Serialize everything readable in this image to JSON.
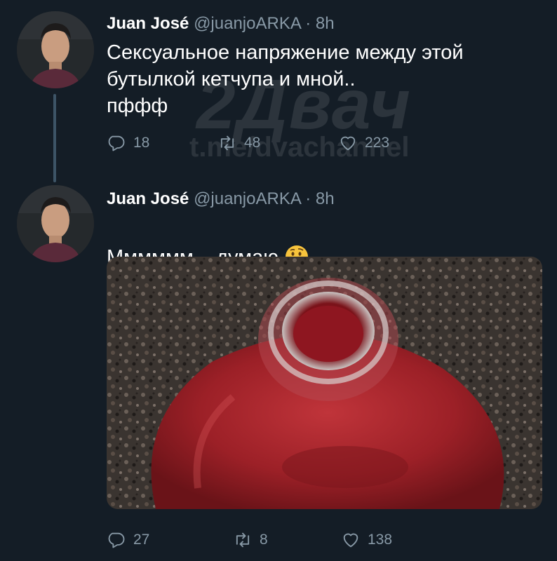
{
  "tweets": [
    {
      "name": "Juan José",
      "handle": "@juanjoARKA",
      "separator": "·",
      "time": "8h",
      "text": "Сексуальное напряжение между этой\nбутылкой кетчупа и мной..\nпффф",
      "replies": "18",
      "retweets": "48",
      "likes": "223"
    },
    {
      "name": "Juan José",
      "handle": "@juanjoARKA",
      "separator": "·",
      "time": "8h",
      "text": "Мммммм... думаю",
      "emoji": "thinking-face-emoji",
      "replies": "27",
      "retweets": "8",
      "likes": "138"
    }
  ],
  "watermark": {
    "brand": "2Двач",
    "channel": "t.me/dvachannel"
  },
  "icons": {
    "reply": "reply-icon",
    "retweet": "retweet-icon",
    "like": "heart-icon"
  },
  "colors": {
    "background": "#141d26",
    "secondary_text": "#8899a6",
    "thread_line": "#3d5466"
  }
}
